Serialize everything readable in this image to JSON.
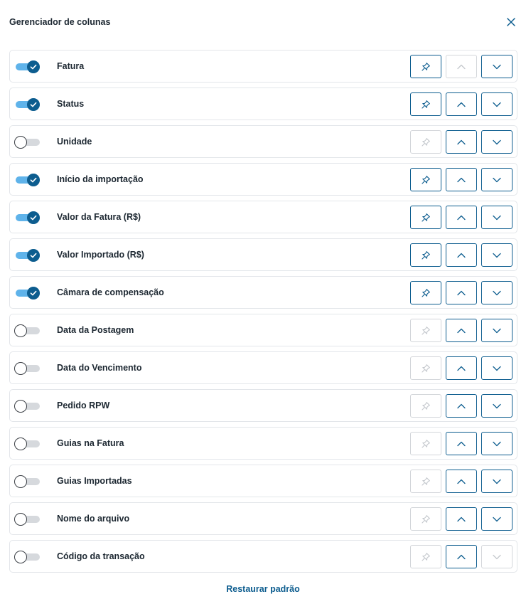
{
  "header": {
    "title": "Gerenciador de colunas",
    "close_icon": "close-icon"
  },
  "colors": {
    "accent": "#0d5d8f",
    "toggle_track_on": "#5fb3ea",
    "toggle_track_off": "#d6d9dd",
    "disabled_border": "#d3d6da"
  },
  "columns": [
    {
      "label": "Fatura",
      "enabled": true,
      "pin_enabled": true,
      "up_enabled": false,
      "down_enabled": true
    },
    {
      "label": "Status",
      "enabled": true,
      "pin_enabled": true,
      "up_enabled": true,
      "down_enabled": true
    },
    {
      "label": "Unidade",
      "enabled": false,
      "pin_enabled": false,
      "up_enabled": true,
      "down_enabled": true
    },
    {
      "label": "Início da importação",
      "enabled": true,
      "pin_enabled": true,
      "up_enabled": true,
      "down_enabled": true
    },
    {
      "label": "Valor da Fatura (R$)",
      "enabled": true,
      "pin_enabled": true,
      "up_enabled": true,
      "down_enabled": true
    },
    {
      "label": "Valor Importado (R$)",
      "enabled": true,
      "pin_enabled": true,
      "up_enabled": true,
      "down_enabled": true
    },
    {
      "label": "Câmara de compensação",
      "enabled": true,
      "pin_enabled": true,
      "up_enabled": true,
      "down_enabled": true
    },
    {
      "label": "Data da Postagem",
      "enabled": false,
      "pin_enabled": false,
      "up_enabled": true,
      "down_enabled": true
    },
    {
      "label": "Data do Vencimento",
      "enabled": false,
      "pin_enabled": false,
      "up_enabled": true,
      "down_enabled": true
    },
    {
      "label": "Pedido RPW",
      "enabled": false,
      "pin_enabled": false,
      "up_enabled": true,
      "down_enabled": true
    },
    {
      "label": "Guias na Fatura",
      "enabled": false,
      "pin_enabled": false,
      "up_enabled": true,
      "down_enabled": true
    },
    {
      "label": "Guias Importadas",
      "enabled": false,
      "pin_enabled": false,
      "up_enabled": true,
      "down_enabled": true
    },
    {
      "label": "Nome do arquivo",
      "enabled": false,
      "pin_enabled": false,
      "up_enabled": true,
      "down_enabled": true
    },
    {
      "label": "Código da transação",
      "enabled": false,
      "pin_enabled": false,
      "up_enabled": true,
      "down_enabled": false
    }
  ],
  "icons": {
    "toggle_check": "check-icon",
    "pin": "pin-icon",
    "up": "chevron-up-icon",
    "down": "chevron-down-icon"
  },
  "footer": {
    "restore_label": "Restaurar padrão"
  }
}
